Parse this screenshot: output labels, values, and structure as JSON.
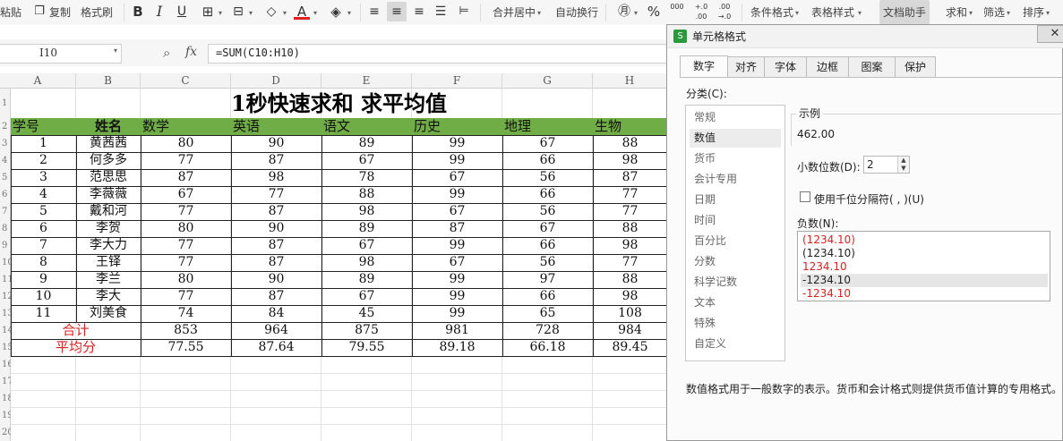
{
  "toolbar": {
    "paste": "粘贴",
    "copy": "复制",
    "format_painter": "格式刷",
    "bold": "B",
    "italic": "I",
    "underline": "U",
    "merge_center": "合并居中",
    "wrap_text": "自动换行",
    "percent": "%",
    "thousands": "000",
    "inc_decimal": "+.0 .00",
    "dec_decimal": ".00 →.0",
    "conditional_format": "条件格式",
    "table_style": "表格样式",
    "doc_assistant": "文档助手",
    "sum": "求和",
    "filter": "筛选",
    "sort": "排序"
  },
  "formula_bar": {
    "name_box": "I10",
    "fx": "fx",
    "formula": "=SUM(C10:H10)"
  },
  "sheet": {
    "columns": [
      "A",
      "B",
      "C",
      "D",
      "E",
      "F",
      "G",
      "H"
    ],
    "row_numbers": [
      "1",
      "2",
      "3",
      "4",
      "5",
      "6",
      "7",
      "8",
      "9",
      "10",
      "11",
      "12",
      "13",
      "14",
      "15",
      "16",
      "17",
      "18",
      "19",
      "20"
    ],
    "title": "1秒快速求和  求平均值",
    "headers": [
      "学号",
      "姓名",
      "数学",
      "英语",
      "语文",
      "历史",
      "地理",
      "生物"
    ],
    "rows": [
      [
        "1",
        "黄茜茜",
        "80",
        "90",
        "89",
        "99",
        "67",
        "88"
      ],
      [
        "2",
        "何多多",
        "77",
        "87",
        "67",
        "99",
        "66",
        "98"
      ],
      [
        "3",
        "范思思",
        "87",
        "98",
        "78",
        "67",
        "56",
        "87"
      ],
      [
        "4",
        "李薇薇",
        "67",
        "77",
        "88",
        "99",
        "66",
        "77"
      ],
      [
        "5",
        "戴和河",
        "77",
        "87",
        "98",
        "67",
        "56",
        "77"
      ],
      [
        "6",
        "李贺",
        "80",
        "90",
        "89",
        "87",
        "67",
        "88"
      ],
      [
        "7",
        "李大力",
        "77",
        "87",
        "67",
        "99",
        "66",
        "98"
      ],
      [
        "8",
        "王铎",
        "77",
        "87",
        "98",
        "67",
        "56",
        "77"
      ],
      [
        "9",
        "李兰",
        "80",
        "90",
        "89",
        "99",
        "97",
        "88"
      ],
      [
        "10",
        "李大",
        "77",
        "87",
        "67",
        "99",
        "66",
        "98"
      ],
      [
        "11",
        "刘美食",
        "74",
        "84",
        "45",
        "99",
        "65",
        "108"
      ]
    ],
    "total_label": "合计",
    "totals": [
      "853",
      "964",
      "875",
      "981",
      "728",
      "984"
    ],
    "avg_label": "平均分",
    "averages": [
      "77.55",
      "87.64",
      "79.55",
      "89.18",
      "66.18",
      "89.45"
    ]
  },
  "dialog": {
    "title": "单元格格式",
    "tabs": [
      "数字",
      "对齐",
      "字体",
      "边框",
      "图案",
      "保护"
    ],
    "active_tab": "数字",
    "category_label": "分类(C):",
    "categories": [
      "常规",
      "数值",
      "货币",
      "会计专用",
      "日期",
      "时间",
      "百分比",
      "分数",
      "科学记数",
      "文本",
      "特殊",
      "自定义"
    ],
    "selected_category": "数值",
    "sample_label": "示例",
    "sample_value": "462.00",
    "decimals_label": "小数位数(D):",
    "decimals_value": "2",
    "thousands_label": "使用千位分隔符( , )(U)",
    "negative_label": "负数(N):",
    "negative_formats": [
      {
        "text": "(1234.10)",
        "color": "#d42222"
      },
      {
        "text": "(1234.10)",
        "color": "#222222"
      },
      {
        "text": "1234.10",
        "color": "#d42222"
      },
      {
        "text": "-1234.10",
        "color": "#222222"
      },
      {
        "text": "-1234.10",
        "color": "#d42222"
      }
    ],
    "selected_negative": 3,
    "description": "数值格式用于一般数字的表示。货币和会计格式则提供货币值计算的专用格式。"
  },
  "colors": {
    "header_fill": "#70ad47",
    "accent_red": "#d42222",
    "app_green": "#2b9a3c"
  }
}
